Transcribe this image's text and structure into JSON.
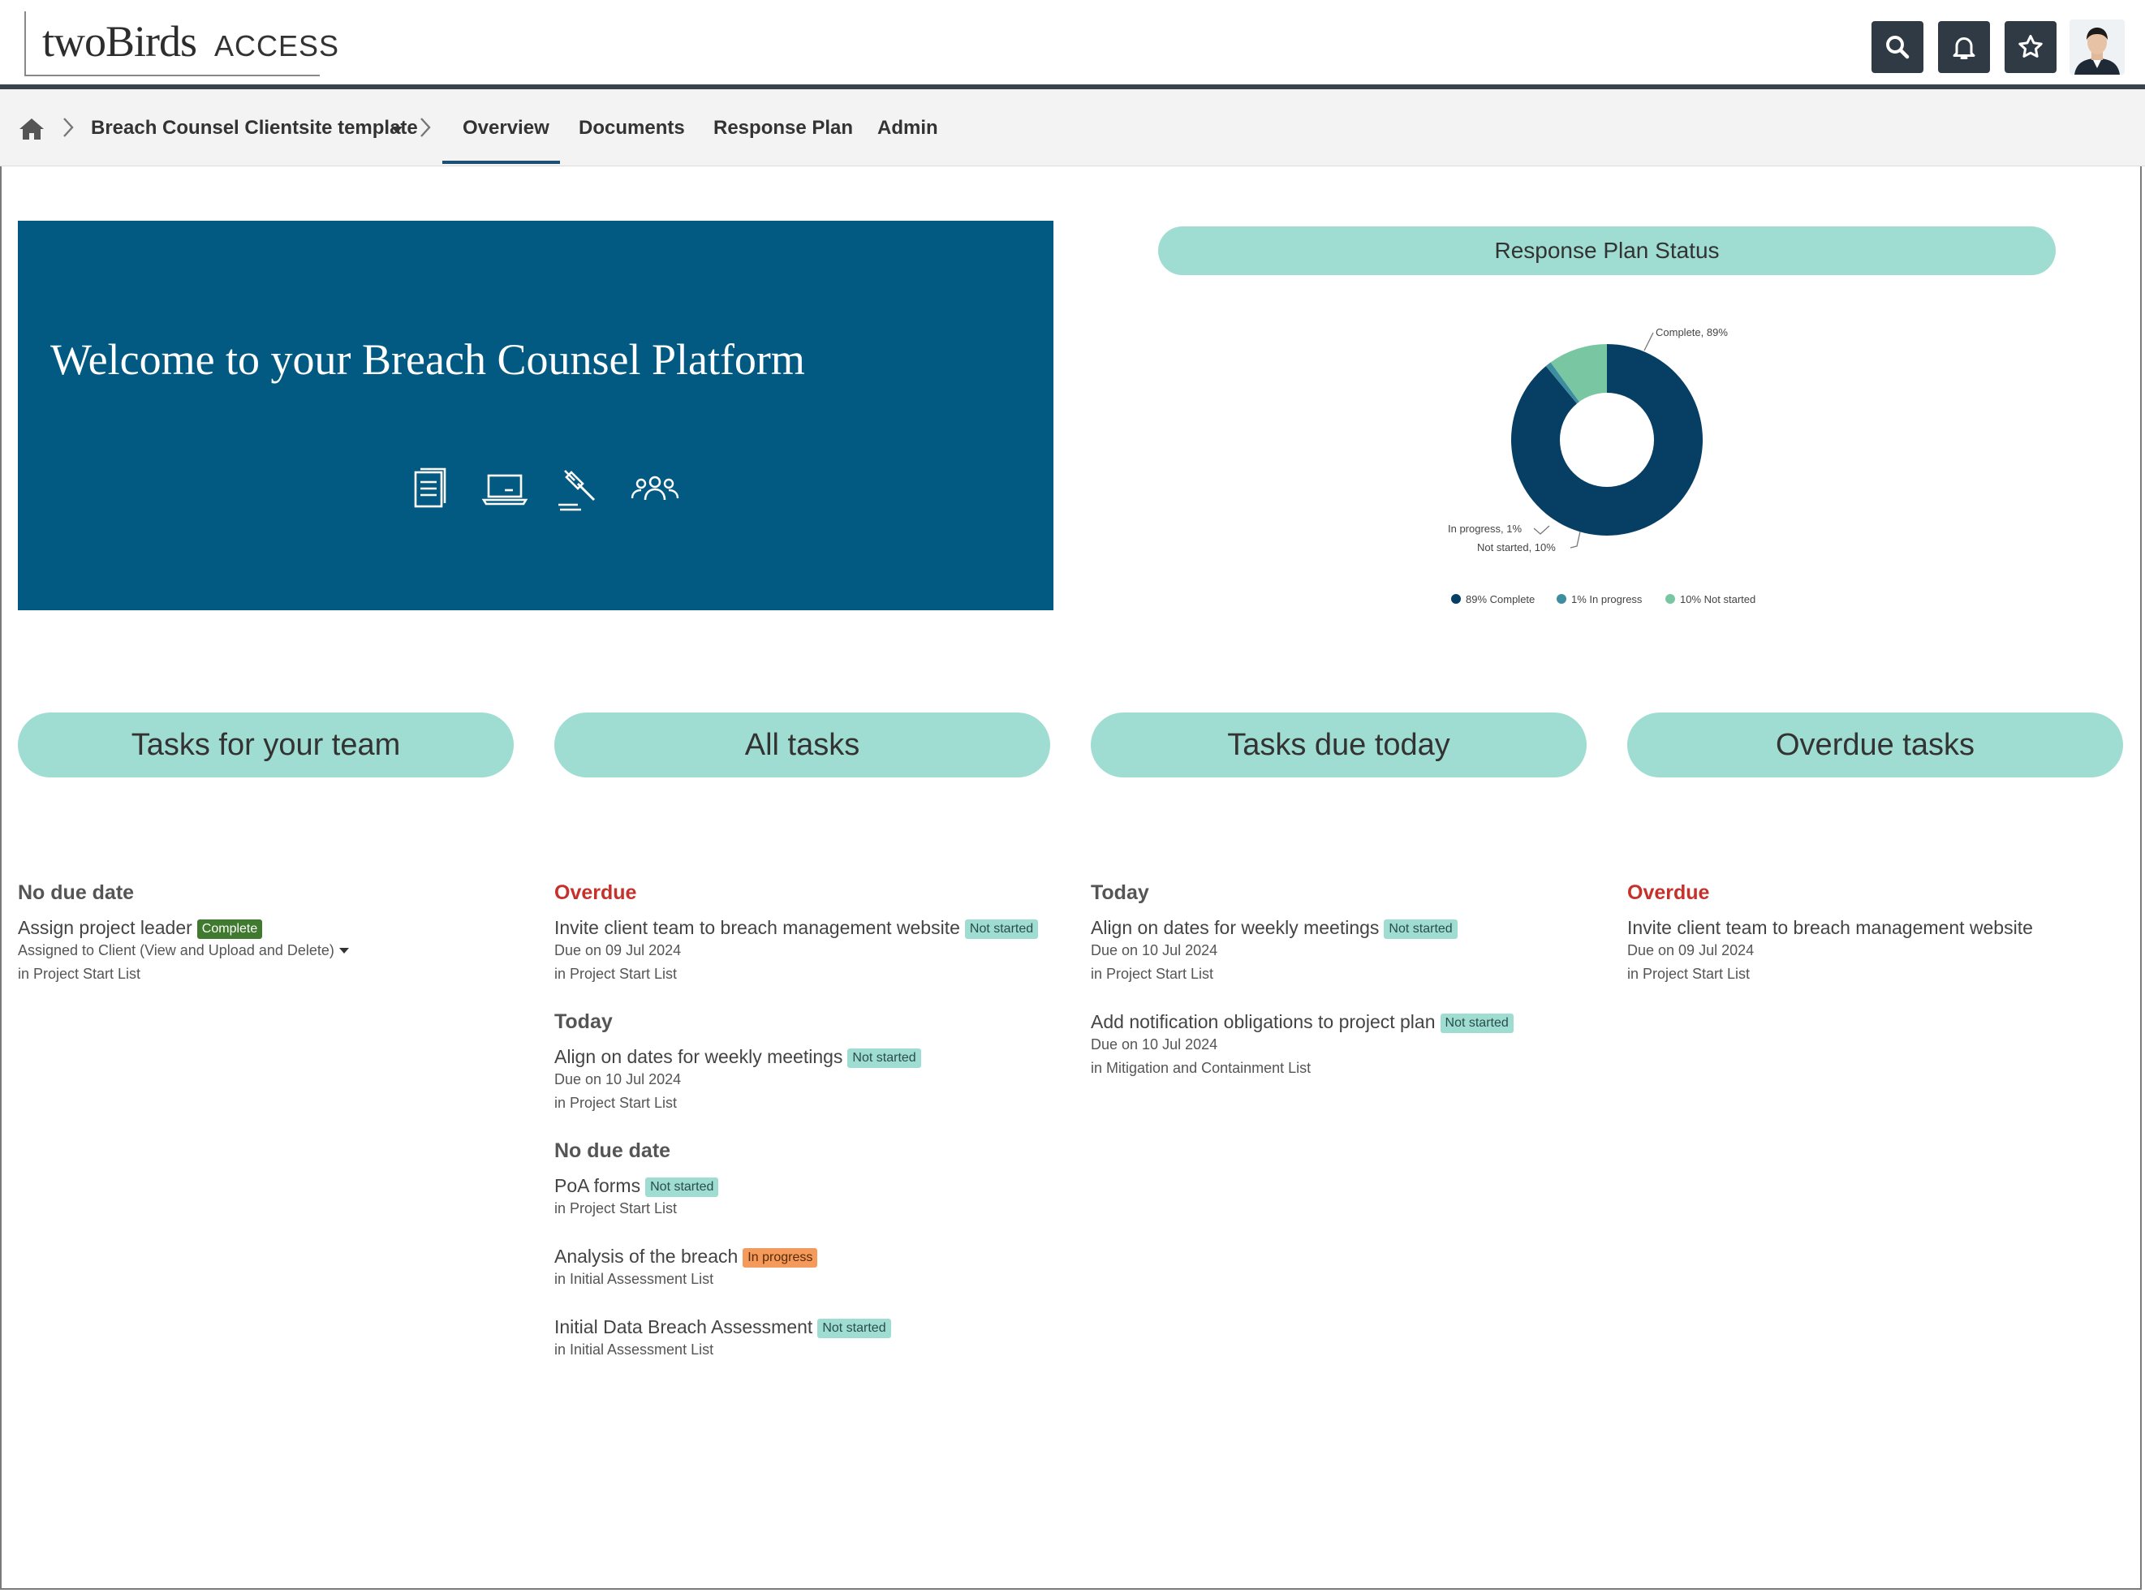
{
  "header": {
    "logo_main": "twoBirds",
    "logo_sub": "ACCESS"
  },
  "nav": {
    "breadcrumb": "Breach Counsel Clientsite template",
    "tabs": [
      {
        "label": "Overview",
        "active": true
      },
      {
        "label": "Documents",
        "active": false
      },
      {
        "label": "Response Plan",
        "active": false
      },
      {
        "label": "Admin",
        "active": false
      }
    ]
  },
  "banner": {
    "title": "Welcome to your Breach Counsel Platform",
    "icons": [
      "document-icon",
      "laptop-icon",
      "gavel-icon",
      "team-icon"
    ]
  },
  "response_plan": {
    "title": "Response Plan Status"
  },
  "chart_data": {
    "type": "pie",
    "categories": [
      "Complete",
      "In progress",
      "Not started"
    ],
    "values": [
      89,
      1,
      10
    ],
    "colors": [
      "#073f64",
      "#3e8ea0",
      "#79c6a3"
    ],
    "slice_labels": [
      "Complete, 89%",
      "In progress, 1%",
      "Not started, 10%"
    ],
    "legend": [
      "89% Complete",
      "1% In progress",
      "10% Not started"
    ],
    "legend_position": "bottom"
  },
  "sections": [
    {
      "title": "Tasks for your team"
    },
    {
      "title": "All tasks"
    },
    {
      "title": "Tasks due today"
    },
    {
      "title": "Overdue tasks"
    }
  ],
  "columns": {
    "team": {
      "groups": [
        {
          "label": "No due date",
          "tasks": [
            {
              "title": "Assign project leader",
              "status": "Complete",
              "assigned": "Assigned to Client (View and Upload and Delete)",
              "list": "in Project Start List"
            }
          ]
        }
      ]
    },
    "all": {
      "groups": [
        {
          "label": "Overdue",
          "tasks": [
            {
              "title": "Invite client team to breach management website",
              "status": "Not started",
              "due": "Due on 09 Jul 2024",
              "list": "in Project Start List"
            }
          ]
        },
        {
          "label": "Today",
          "tasks": [
            {
              "title": "Align on dates for weekly meetings",
              "status": "Not started",
              "due": "Due on 10 Jul 2024",
              "list": "in Project Start List"
            }
          ]
        },
        {
          "label": "No due date",
          "tasks": [
            {
              "title": "PoA forms",
              "status": "Not started",
              "list": "in Project Start List"
            },
            {
              "title": "Analysis of the breach",
              "status": "In progress",
              "list": "in Initial Assessment List"
            },
            {
              "title": "Initial Data Breach Assessment",
              "status": "Not started",
              "list": "in Initial Assessment List"
            }
          ]
        }
      ]
    },
    "today": {
      "groups": [
        {
          "label": "Today",
          "tasks": [
            {
              "title": "Align on dates for weekly meetings",
              "status": "Not started",
              "due": "Due on 10 Jul 2024",
              "list": "in Project Start List"
            },
            {
              "title": "Add notification obligations to project plan",
              "status": "Not started",
              "due": "Due on 10 Jul 2024",
              "list": "in Mitigation and Containment List"
            }
          ]
        }
      ]
    },
    "overdue": {
      "groups": [
        {
          "label": "Overdue",
          "tasks": [
            {
              "title": "Invite client team to breach management website",
              "due": "Due on 09 Jul 2024",
              "list": "in Project Start List"
            }
          ]
        }
      ]
    }
  }
}
